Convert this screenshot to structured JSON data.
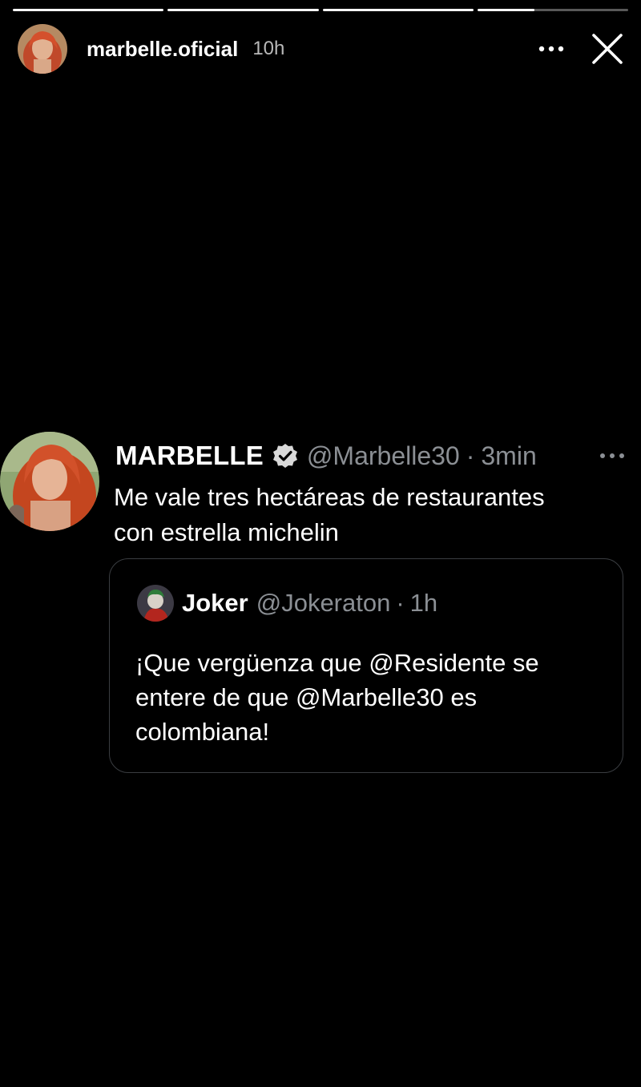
{
  "story": {
    "progress": [
      1,
      1,
      1,
      0.38
    ],
    "username": "marbelle.oficial",
    "time": "10h",
    "icons": {
      "more": "more-horizontal-icon",
      "close": "close-icon"
    }
  },
  "tweet": {
    "name": "MARBELLE",
    "verified": true,
    "handle": "@Marbelle30",
    "separator": "·",
    "age": "3min",
    "text_lines": [
      "Me vale tres hectáreas de restaurantes",
      "con estrella michelin"
    ],
    "quote": {
      "name": "Joker",
      "handle": "@Jokeraton",
      "separator": "·",
      "age": "1h",
      "text_lines": [
        "¡Que vergüenza que @Residente se",
        "entere de que @Marbelle30 es",
        "colombiana!"
      ]
    }
  },
  "colors": {
    "background": "#000000",
    "text": "#ffffff",
    "secondary_text": "#8b8f94",
    "quote_border": "#3a3d41"
  }
}
